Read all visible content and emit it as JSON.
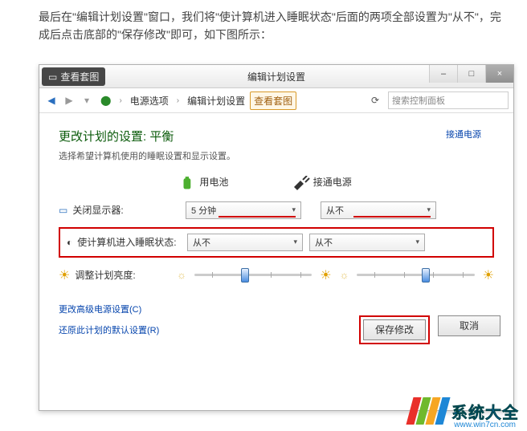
{
  "intro": "最后在\"编辑计划设置\"窗口，我们将\"使计算机进入睡眠状态\"后面的两项全部设置为\"从不\"，完成后点击底部的\"保存修改\"即可，如下图所示：",
  "overlay_badge": "查看套图",
  "window": {
    "title": "编辑计划设置",
    "min": "–",
    "max": "□",
    "close": "×"
  },
  "nav": {
    "crumb1": "电源选项",
    "crumb2": "编辑计划设置",
    "crumb_current": "查看套图",
    "search_placeholder": "搜索控制面板"
  },
  "page": {
    "heading": "更改计划的设置: 平衡",
    "subheading": "选择希望计算机使用的睡眠设置和显示设置。",
    "power_source_link": "接通电源",
    "col_battery": "用电池",
    "col_plugged": "接通电源",
    "row_display": "关闭显示器:",
    "row_display_batt": "5 分钟",
    "row_display_plug": "从不",
    "row_sleep": "使计算机进入睡眠状态:",
    "row_sleep_batt": "从不",
    "row_sleep_plug": "从不",
    "row_brightness": "调整计划亮度:",
    "link_advanced": "更改高级电源设置(C)",
    "link_restore": "还原此计划的默认设置(R)",
    "btn_save": "保存修改",
    "btn_cancel": "取消"
  },
  "watermark": {
    "text": "系统大全",
    "url": "www.win7cn.com"
  }
}
